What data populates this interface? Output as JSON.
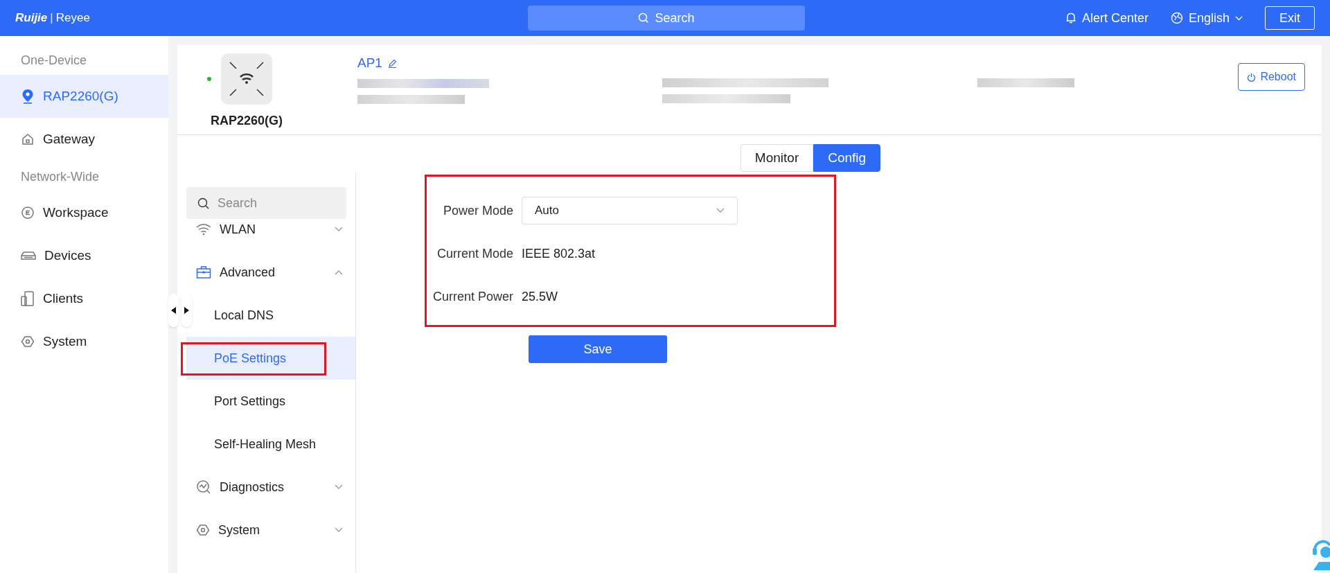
{
  "topbar": {
    "logo": [
      "Ruijie",
      "|",
      "Reyee"
    ],
    "search": {
      "placeholder": "Search"
    },
    "alert": "Alert Center",
    "language": "English",
    "exit": "Exit"
  },
  "sidebar": {
    "sections": [
      {
        "heading": "One-Device",
        "items": [
          {
            "label": "RAP2260(G)",
            "kind": "pin",
            "selected": true
          }
        ]
      },
      {
        "heading": "Network-Wide",
        "items": [
          {
            "label": "Workspace",
            "kind": "workspace",
            "selected": false
          },
          {
            "label": "Devices",
            "kind": "devices",
            "selected": false
          },
          {
            "label": "Clients",
            "kind": "clients",
            "selected": false
          },
          {
            "label": "System",
            "kind": "system",
            "selected": false
          }
        ]
      }
    ],
    "top_items": [
      {
        "label": "Gateway",
        "kind": "home",
        "selected": false
      }
    ]
  },
  "device": {
    "model": "RAP2260(G)",
    "online": true,
    "name": "AP1",
    "reboot": "Reboot"
  },
  "view_tabs": [
    {
      "label": "Monitor",
      "selected": false
    },
    {
      "label": "Config",
      "selected": true
    }
  ],
  "config_nav": {
    "search": {
      "placeholder": "Search"
    },
    "items": [
      {
        "label": "WLAN",
        "kind": "wifi",
        "expanded": false,
        "selected": false
      },
      {
        "label": "Advanced",
        "kind": "toolbox",
        "expanded": true,
        "selected": false,
        "children": [
          {
            "label": "Local DNS",
            "selected": false,
            "highlighted": false
          },
          {
            "label": "PoE Settings",
            "selected": true,
            "highlighted": true
          },
          {
            "label": "Port Settings",
            "selected": false,
            "highlighted": false
          },
          {
            "label": "Self-Healing Mesh",
            "selected": false,
            "highlighted": false
          }
        ]
      },
      {
        "label": "Diagnostics",
        "kind": "diagnostics",
        "expanded": false,
        "selected": false
      },
      {
        "label": "System",
        "kind": "system",
        "expanded": false,
        "selected": false
      }
    ]
  },
  "form": {
    "highlighted": true,
    "fields": [
      {
        "kind": "select",
        "label": "Power Mode",
        "value": "Auto"
      },
      {
        "kind": "text",
        "label": "Current Mode",
        "value": "IEEE 802.3at"
      },
      {
        "kind": "text",
        "label": "Current Power",
        "value": "25.5W"
      }
    ],
    "save": "Save"
  }
}
